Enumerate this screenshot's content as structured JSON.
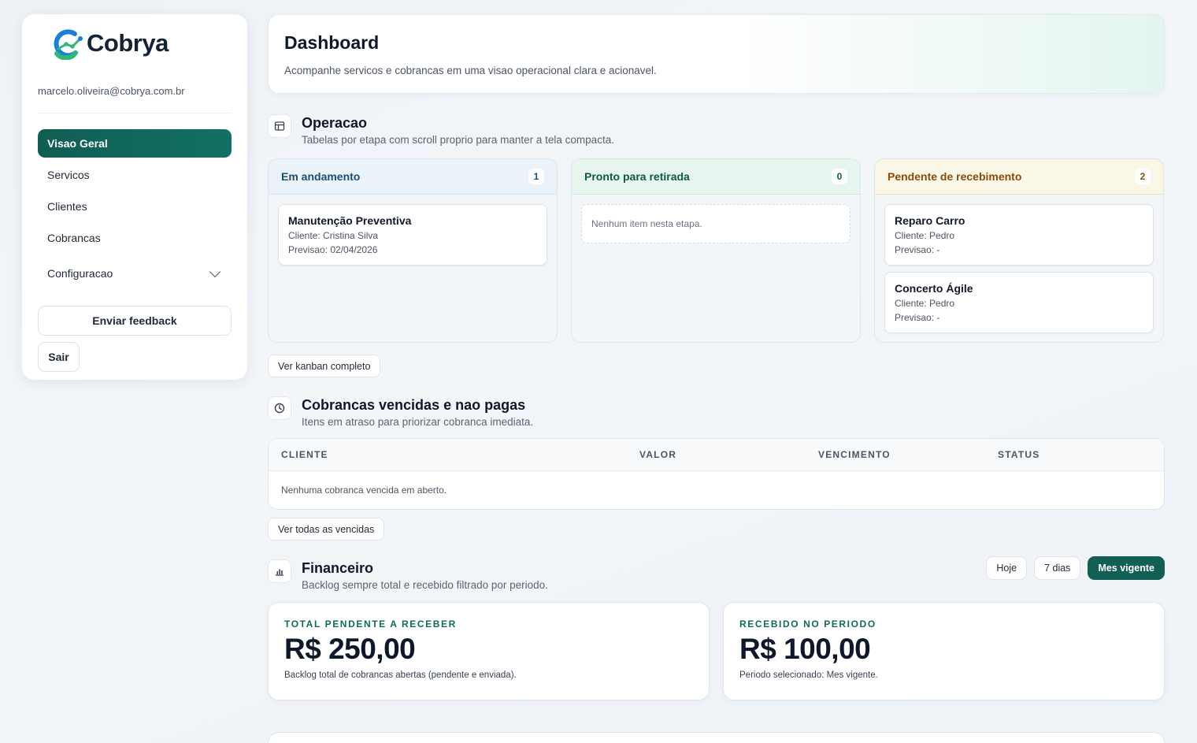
{
  "brand": {
    "name": "Cobrya",
    "colors": {
      "primary": "#125f54",
      "logo_blue": "#1a7fd6",
      "logo_green": "#2fb87a"
    }
  },
  "user": {
    "email": "marcelo.oliveira@cobrya.com.br"
  },
  "sidebar": {
    "items": [
      {
        "label": "Visao Geral",
        "active": true
      },
      {
        "label": "Servicos"
      },
      {
        "label": "Clientes"
      },
      {
        "label": "Cobrancas"
      }
    ],
    "config_label": "Configuracao",
    "feedback_label": "Enviar feedback",
    "logout_label": "Sair"
  },
  "hero": {
    "title": "Dashboard",
    "subtitle": "Acompanhe servicos e cobrancas em uma visao operacional clara e acionavel."
  },
  "operacao": {
    "title": "Operacao",
    "subtitle": "Tabelas por etapa com scroll proprio para manter a tela compacta.",
    "columns": [
      {
        "title": "Em andamento",
        "count": "1",
        "cards": [
          {
            "title": "Manutenção Preventiva",
            "client": "Cliente: Cristina Silva",
            "forecast": "Previsao: 02/04/2026"
          }
        ]
      },
      {
        "title": "Pronto para retirada",
        "count": "0",
        "empty": "Nenhum item nesta etapa."
      },
      {
        "title": "Pendente de recebimento",
        "count": "2",
        "cards": [
          {
            "title": "Reparo Carro",
            "client": "Cliente: Pedro",
            "forecast": "Previsao: -"
          },
          {
            "title": "Concerto Ágile",
            "client": "Cliente: Pedro",
            "forecast": "Previsao: -"
          }
        ]
      }
    ],
    "kanban_button": "Ver kanban completo"
  },
  "vencidas": {
    "title": "Cobrancas vencidas e nao pagas",
    "subtitle": "Itens em atraso para priorizar cobranca imediata.",
    "columns": [
      "CLIENTE",
      "VALOR",
      "VENCIMENTO",
      "STATUS"
    ],
    "empty": "Nenhuma cobranca vencida em aberto.",
    "button": "Ver todas as vencidas"
  },
  "financeiro": {
    "title": "Financeiro",
    "subtitle": "Backlog sempre total e recebido filtrado por periodo.",
    "periods": [
      "Hoje",
      "7 dias",
      "Mes vigente"
    ],
    "active_period": "Mes vigente",
    "cards": [
      {
        "label": "TOTAL PENDENTE A RECEBER",
        "value": "R$ 250,00",
        "note": "Backlog total de cobrancas abertas (pendente e enviada)."
      },
      {
        "label": "RECEBIDO NO PERIODO",
        "value": "R$ 100,00",
        "note": "Periodo selecionado: Mes vigente."
      }
    ]
  }
}
